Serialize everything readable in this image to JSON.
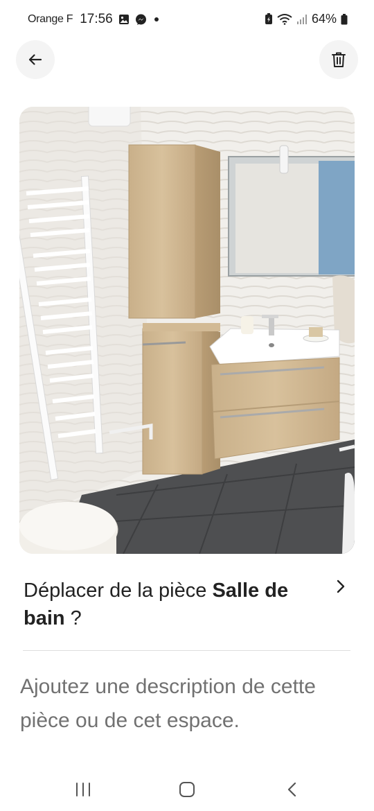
{
  "status_bar": {
    "carrier": "Orange F",
    "time": "17:56",
    "battery": "64%",
    "icons": [
      "gallery-icon",
      "messenger-icon",
      "dot-icon",
      "battery-saver-icon",
      "wifi-icon",
      "signal-icon",
      "battery-icon"
    ]
  },
  "header": {
    "back_icon": "arrow-left-icon",
    "delete_icon": "trash-icon"
  },
  "photo": {
    "subject": "bathroom-photo"
  },
  "move_prompt": {
    "prefix": "Déplacer de la pièce ",
    "room": "Salle de bain",
    "suffix": " ?"
  },
  "description": {
    "placeholder": "Ajoutez une description de cette pièce ou de cet espace."
  },
  "nav_bar": {
    "icons": [
      "recent-apps-icon",
      "home-icon",
      "back-nav-icon"
    ]
  }
}
